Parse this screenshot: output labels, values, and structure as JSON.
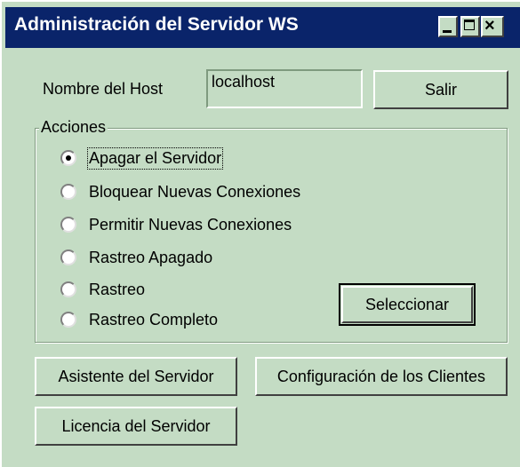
{
  "window": {
    "title": "Administración del Servidor WS",
    "controls": {
      "minimize": "_",
      "maximize": "□",
      "close": "×"
    }
  },
  "host": {
    "label": "Nombre del Host",
    "value": "localhost"
  },
  "buttons": {
    "salir": "Salir",
    "seleccionar": "Seleccionar",
    "asistente": "Asistente del Servidor",
    "configuracion": "Configuración de los Clientes",
    "licencia": "Licencia del Servidor"
  },
  "acciones": {
    "label": "Acciones",
    "options": [
      {
        "label": "Apagar el Servidor",
        "checked": true
      },
      {
        "label": "Bloquear Nuevas Conexiones",
        "checked": false
      },
      {
        "label": "Permitir Nuevas Conexiones",
        "checked": false
      },
      {
        "label": "Rastreo Apagado",
        "checked": false
      },
      {
        "label": "Rastreo",
        "checked": false
      },
      {
        "label": "Rastreo Completo",
        "checked": false
      }
    ]
  },
  "colors": {
    "background": "#c4dcc4",
    "titlebar": "#0a246a",
    "title_text": "#ffffff"
  }
}
